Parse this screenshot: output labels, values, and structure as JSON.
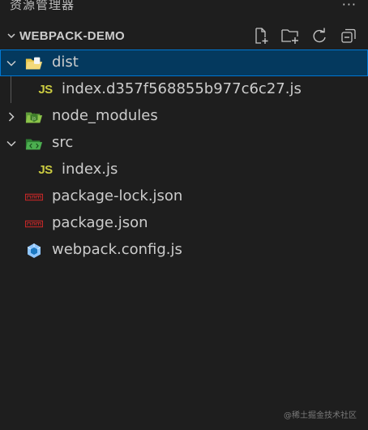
{
  "panel": {
    "title": "资源管理器",
    "more_label": "···"
  },
  "section": {
    "title": "WEBPACK-DEMO",
    "actions": [
      {
        "icon": "new-file-icon"
      },
      {
        "icon": "new-folder-icon"
      },
      {
        "icon": "refresh-icon"
      },
      {
        "icon": "collapse-all-icon"
      }
    ]
  },
  "tree": [
    {
      "name": "dist",
      "type": "folder",
      "expanded": true,
      "selected": true,
      "icon": "folder-dist-icon"
    },
    {
      "name": "index.d357f568855b977c6c27.js",
      "type": "file",
      "icon": "js-file-icon",
      "icon_text": "JS"
    },
    {
      "name": "node_modules",
      "type": "folder",
      "expanded": false,
      "icon": "folder-node-icon"
    },
    {
      "name": "src",
      "type": "folder",
      "expanded": true,
      "icon": "folder-src-icon"
    },
    {
      "name": "index.js",
      "type": "file",
      "icon": "js-file-icon",
      "icon_text": "JS"
    },
    {
      "name": "package-lock.json",
      "type": "file",
      "icon": "npm-json-icon"
    },
    {
      "name": "package.json",
      "type": "file",
      "icon": "npm-json-icon"
    },
    {
      "name": "webpack.config.js",
      "type": "file",
      "icon": "webpack-icon"
    }
  ],
  "watermark": "@稀土掘金技术社区",
  "colors": {
    "background": "#1e1e1e",
    "selection": "#04395e",
    "focus_border": "#0078d4",
    "js_yellow": "#cbcb41",
    "dist_folder": "#e8c64a",
    "node_folder": "#8bc34a",
    "src_folder": "#4caf50",
    "npm_red": "#c62828",
    "webpack_blue": "#8ec5fc"
  }
}
